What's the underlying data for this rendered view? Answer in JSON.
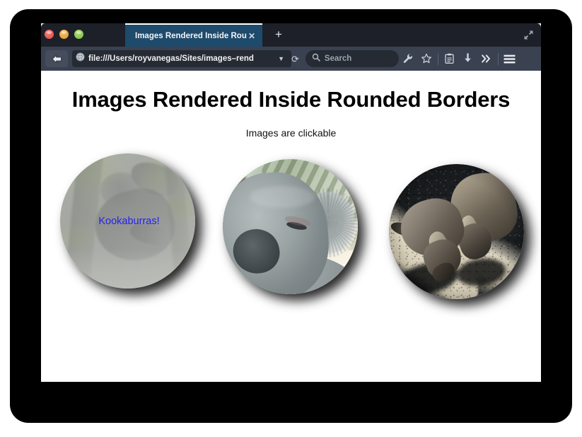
{
  "window": {
    "traffic_lights": [
      {
        "name": "close",
        "color": "#d8453c"
      },
      {
        "name": "minimize",
        "color": "#dd9327"
      },
      {
        "name": "zoom",
        "color": "#76b93b"
      }
    ],
    "fullscreen_icon": "fullscreen-icon"
  },
  "tabs": {
    "active_tab_title": "Images Rendered Inside Roun...",
    "close_label": "✕",
    "new_tab_label": "+"
  },
  "toolbar": {
    "back_icon": "back-arrow-icon",
    "site_icon": "globe-icon",
    "url_value": "file:///Users/royvanegas/Sites/images–rend",
    "url_dropdown_label": "▼",
    "reload_label": "⟳",
    "search_placeholder": "Search",
    "search_icon": "magnifier-icon",
    "icons": [
      {
        "name": "wrench-icon",
        "label": "Customize"
      },
      {
        "name": "star-icon",
        "label": "Bookmark"
      },
      {
        "name": "reader-icon",
        "label": "Reader"
      },
      {
        "name": "download-icon",
        "label": "Downloads"
      },
      {
        "name": "overflow-chevrons-icon",
        "label": "»"
      },
      {
        "name": "hamburger-menu-icon",
        "label": "Menu"
      }
    ]
  },
  "page": {
    "heading": "Images Rendered Inside Rounded Borders",
    "subtitle": "Images are clickable",
    "link_color": "#2222ee",
    "images": [
      {
        "name": "kookaburras",
        "caption": "Kookaburras!",
        "alt": "Faded photo of a kookaburra perched among trees"
      },
      {
        "name": "koala",
        "caption": "",
        "alt": "Close-up of a sleeping koala"
      },
      {
        "name": "wallabies",
        "caption": "",
        "alt": "Two wallabies feeding on sunlit asphalt"
      }
    ]
  }
}
